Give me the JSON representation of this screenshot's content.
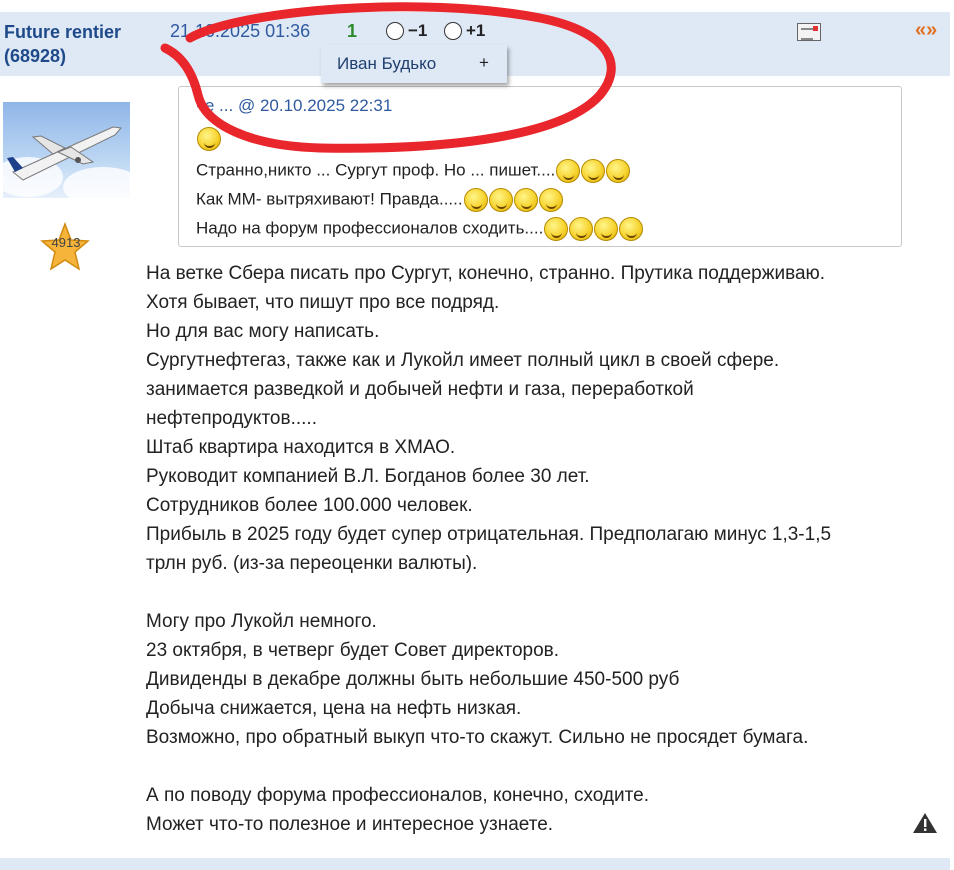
{
  "post": {
    "author": "Future rentier",
    "author_count": "(68928)",
    "datetime": "21.10.2025 01:36",
    "rating": "1",
    "vote_minus": "−1",
    "vote_plus": "+1",
    "user_rating": "4913"
  },
  "popup": {
    "name": "Иван Будько",
    "plus": "+"
  },
  "quote": {
    "header_partial": "че ...",
    "header_at": "@",
    "header_date": "20.10.2025 22:31",
    "lines": [
      "Странно,никто ... Сургут проф. Но ... пишет....",
      "Как ММ- вытряхивают! Правда.....",
      "Надо на форум профессионалов сходить...."
    ]
  },
  "body_lines": [
    "На ветке Сбера писать про Сургут, конечно, странно. Прутика поддерживаю.",
    "Хотя бывает, что пишут про все подряд.",
    "Но для вас могу написать.",
    "Сургутнефтегаз, также как и Лукойл имеет полный цикл в своей сфере.",
    "занимается разведкой и добычей нефти и газа, переработкой",
    "нефтепродуктов.....",
    "Штаб квартира находится в ХМАО.",
    "Руководит компанией В.Л. Богданов более 30 лет.",
    "Сотрудников более 100.000 человек.",
    "Прибыль в 2025 году будет супер отрицательная. Предполагаю минус 1,3-1,5",
    "трлн руб. (из-за переоценки валюты).",
    "",
    "Могу про Лукойл немного.",
    "23 октября, в четверг будет Совет директоров.",
    "Дивиденды в декабре должны быть небольшие 450-500 руб",
    "Добыча снижается, цена на нефть низкая.",
    "Возможно, про обратный выкуп что-то скажут. Сильно не просядет бумага.",
    "",
    "А по поводу форума профессионалов, конечно, сходите.",
    "Может что-то полезное и интересное узнаете."
  ],
  "colors": {
    "header_bg": "#dfe9f6",
    "author": "#1f4a8a",
    "link": "#2f5aa0",
    "rating": "#2a8a2a",
    "quote_arrows": "#e07020",
    "annotation": "#e8262b"
  },
  "icons": [
    "radio-icon",
    "mail-icon",
    "quote-arrows-icon",
    "star-icon",
    "smiley-icon",
    "warning-icon"
  ]
}
